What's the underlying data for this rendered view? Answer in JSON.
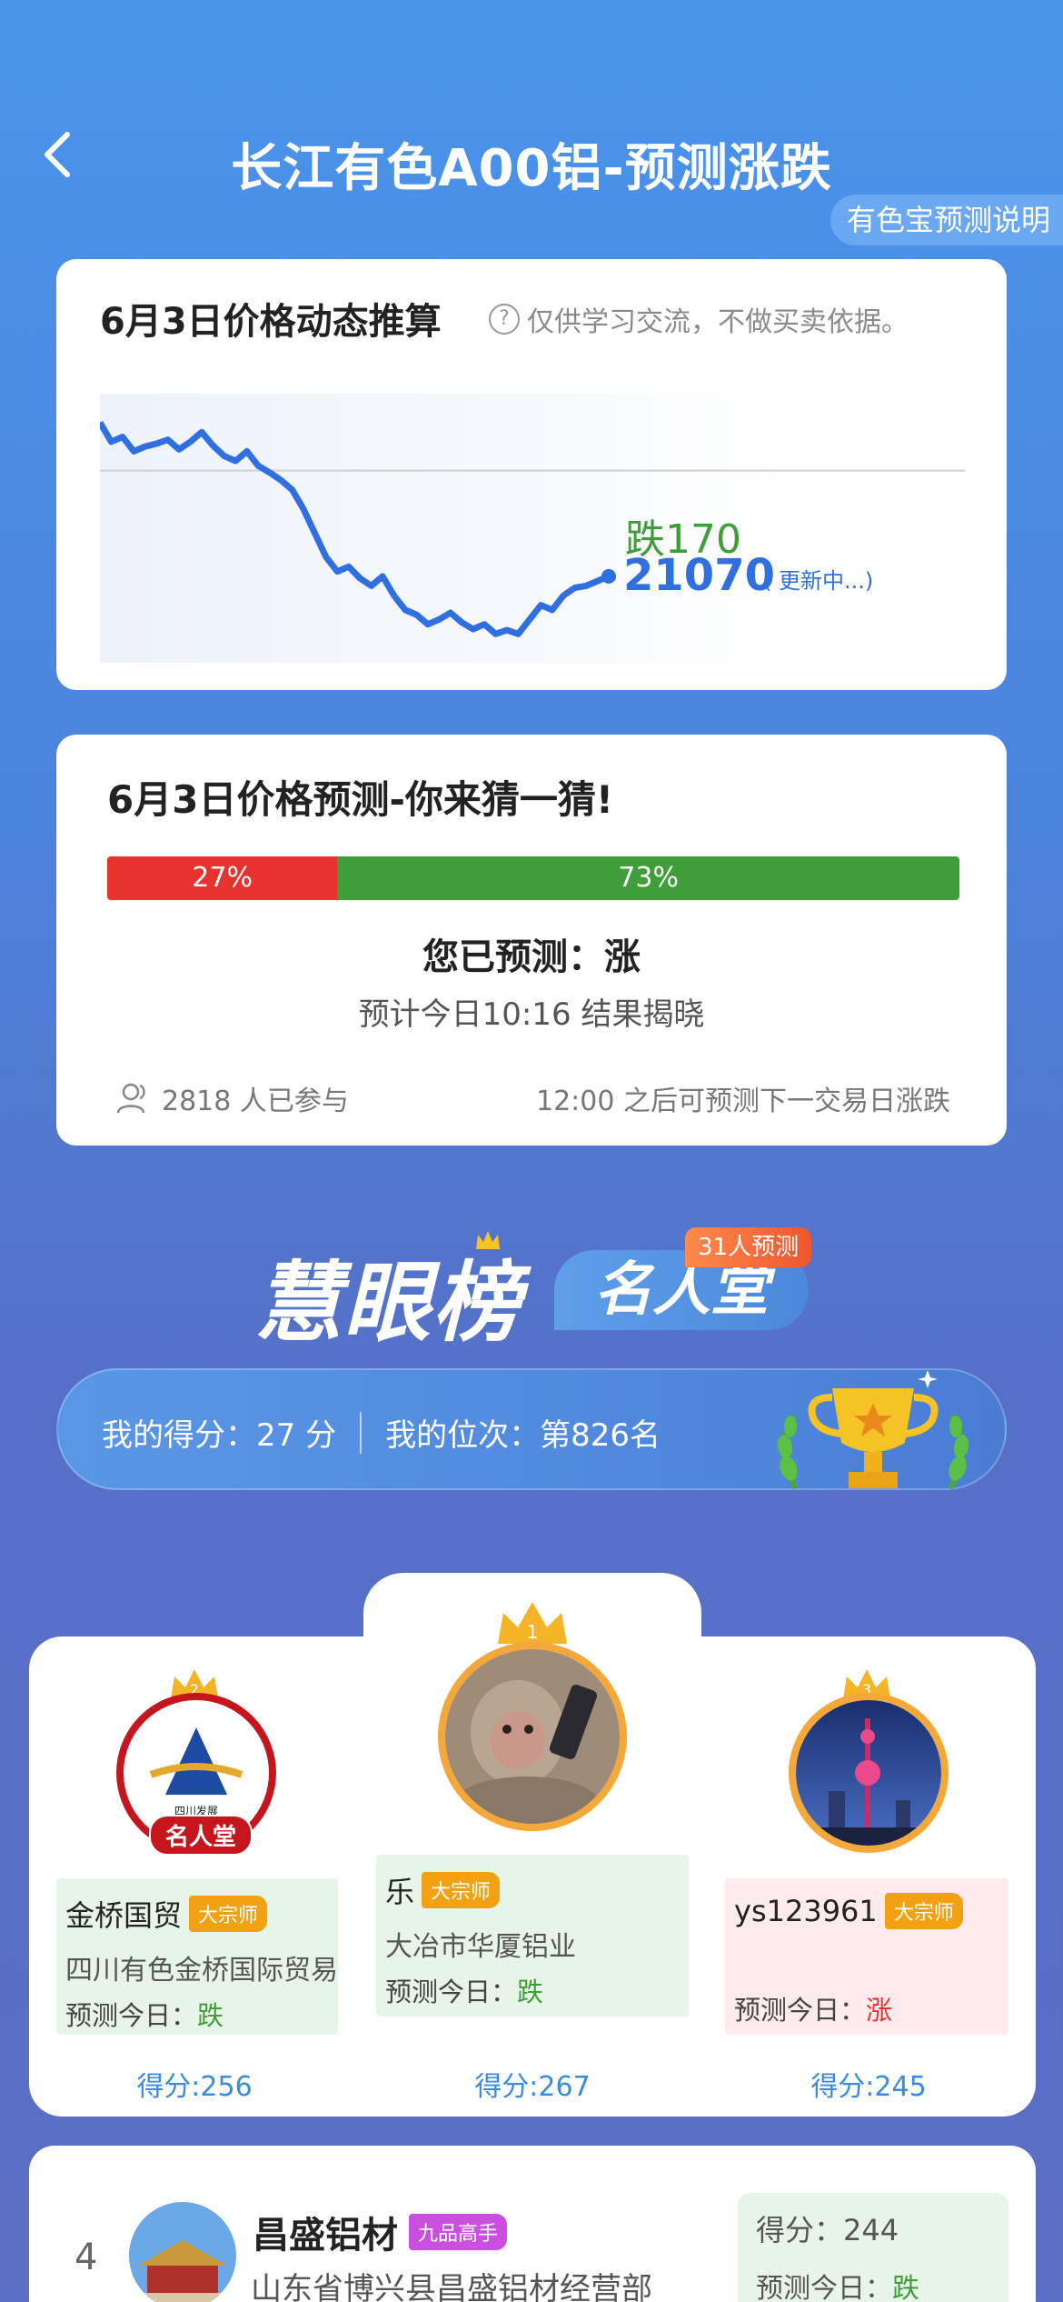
{
  "header": {
    "title": "长江有色A00铝-预测涨跌",
    "help": "有色宝预测说明"
  },
  "trend_card": {
    "title": "6月3日价格动态推算",
    "note": "仅供学习交流，不做买卖依据。",
    "change_label": "跌170",
    "price": "21070",
    "updating": "( 更新中...)"
  },
  "chart_data": {
    "type": "line",
    "title": "",
    "xlabel": "",
    "ylabel": "",
    "reference_value": 21240,
    "series": [
      {
        "name": "",
        "values": [
          21290,
          21270,
          21275,
          21260,
          21265,
          21268,
          21272,
          21262,
          21270,
          21280,
          21266,
          21255,
          21250,
          21260,
          21245,
          21238,
          21230,
          21220,
          21200,
          21175,
          21150,
          21135,
          21140,
          21128,
          21120,
          21130,
          21110,
          21095,
          21090,
          21080,
          21085,
          21092,
          21082,
          21075,
          21080,
          21070,
          21074,
          21070,
          21085,
          21100,
          21095,
          21110,
          21118,
          21120,
          21125,
          21130
        ]
      }
    ],
    "color": "#2f6fe0",
    "grid": false
  },
  "predict_card": {
    "title": "6月3日价格预测-你来猜一猜!",
    "down_pct": "27%",
    "up_pct": "73%",
    "down_value": 27,
    "up_value": 73,
    "my_prediction": "您已预测：涨",
    "reveal_time": "预计今日10:16 结果揭晓",
    "participants": "2818 人已参与",
    "next_note": "12:00 之后可预测下一交易日涨跌"
  },
  "hall": {
    "title": "慧眼榜",
    "hall_label": "名人堂",
    "badge": "31人预测",
    "my_score": "我的得分：27 分",
    "my_rank": "我的位次：第826名"
  },
  "podium": [
    {
      "rank": "2",
      "name": "金桥国贸",
      "tag": "大宗师",
      "company": "四川有色金桥国际贸易",
      "pred_label": "预测今日：",
      "pred": "跌",
      "score": "得分:256",
      "fame": "名人堂",
      "logo_text": "四川发展"
    },
    {
      "rank": "1",
      "name": "乐",
      "tag": "大宗师",
      "company": "大冶市华厦铝业",
      "pred_label": "预测今日：",
      "pred": "跌",
      "score": "得分:267"
    },
    {
      "rank": "3",
      "name": "ys123961",
      "tag": "大宗师",
      "company": "",
      "pred_label": "预测今日：",
      "pred": "涨",
      "score": "得分:245"
    }
  ],
  "list": [
    {
      "rank": "4",
      "name": "昌盛铝材",
      "tag": "九品高手",
      "company": "山东省博兴县昌盛铝材经营部",
      "score": "得分：244",
      "pred_label": "预测今日：",
      "pred": "跌"
    }
  ]
}
